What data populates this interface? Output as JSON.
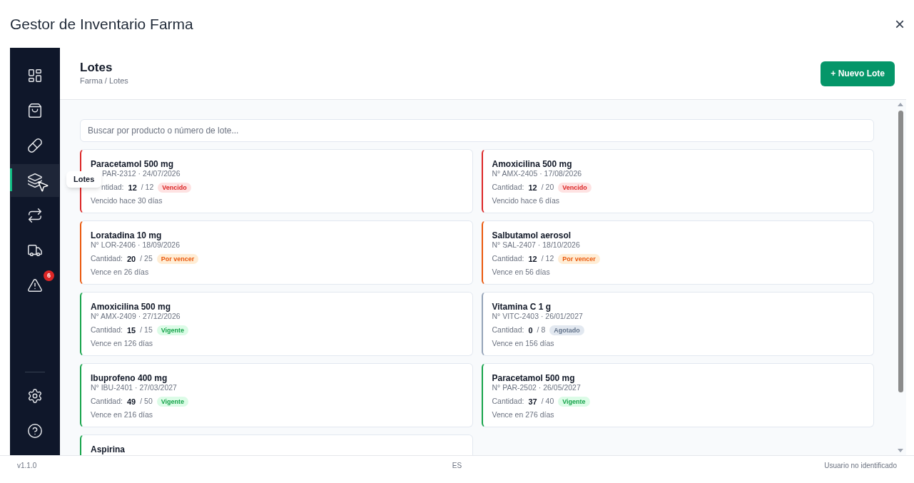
{
  "window": {
    "title": "Gestor de Inventario Farma",
    "close": "×"
  },
  "sidebar": {
    "items": [
      {
        "kind": "dashboard",
        "selected": false
      },
      {
        "kind": "sales",
        "selected": false
      },
      {
        "kind": "products",
        "selected": false
      },
      {
        "kind": "lots",
        "selected": true
      },
      {
        "kind": "movements",
        "selected": false
      },
      {
        "kind": "suppliers",
        "selected": false
      },
      {
        "kind": "alerts",
        "selected": false,
        "badge": "6"
      }
    ],
    "bottom_items": [
      {
        "kind": "settings",
        "selected": false
      },
      {
        "kind": "help",
        "selected": false
      }
    ],
    "tooltip": "Lotes"
  },
  "header": {
    "title": "Lotes",
    "breadcrumb": "Farma / Lotes",
    "new_button": "+ Nuevo Lote"
  },
  "search": {
    "placeholder": "Buscar por producto o número de lote..."
  },
  "lots": [
    {
      "name": "Paracetamol 500 mg",
      "lot": "PAR-2312 · 24/07/2026",
      "quantity_label": "ntidad:",
      "quantity": "12",
      "total": "/ 12",
      "status": "Vencido",
      "kind": "expired",
      "expiry": "Vencido hace 30 días",
      "covered": true
    },
    {
      "name": "Amoxicilina 500 mg",
      "lot": "N° AMX-2405 · 17/08/2026",
      "quantity_label": "Cantidad:",
      "quantity": "12",
      "total": "/ 20",
      "status": "Vencido",
      "kind": "expired",
      "expiry": "Vencido hace 6 días",
      "covered": false
    },
    {
      "name": "Loratadina 10 mg",
      "lot": "N° LOR-2406 · 18/09/2026",
      "quantity_label": "Cantidad:",
      "quantity": "20",
      "total": "/ 25",
      "status": "Por vencer",
      "kind": "expiring",
      "expiry": "Vence en 26 días",
      "covered": false
    },
    {
      "name": "Salbutamol aerosol",
      "lot": "N° SAL-2407 · 18/10/2026",
      "quantity_label": "Cantidad:",
      "quantity": "12",
      "total": "/ 12",
      "status": "Por vencer",
      "kind": "expiring",
      "expiry": "Vence en 56 días",
      "covered": false
    },
    {
      "name": "Amoxicilina 500 mg",
      "lot": "N° AMX-2409 · 27/12/2026",
      "quantity_label": "Cantidad:",
      "quantity": "15",
      "total": "/ 15",
      "status": "Vigente",
      "kind": "valid",
      "expiry": "Vence en 126 días",
      "covered": false
    },
    {
      "name": "Vitamina C 1 g",
      "lot": "N° VITC-2403 · 26/01/2027",
      "quantity_label": "Cantidad:",
      "quantity": "0",
      "total": "/ 8",
      "status": "Agotado",
      "kind": "depleted",
      "expiry": "Vence en 156 días",
      "covered": false
    },
    {
      "name": "Ibuprofeno 400 mg",
      "lot": "N° IBU-2401 · 27/03/2027",
      "quantity_label": "Cantidad:",
      "quantity": "49",
      "total": "/ 50",
      "status": "Vigente",
      "kind": "valid",
      "expiry": "Vence en 216 días",
      "covered": false
    },
    {
      "name": "Paracetamol 500 mg",
      "lot": "N° PAR-2502 · 26/05/2027",
      "quantity_label": "Cantidad:",
      "quantity": "37",
      "total": "/ 40",
      "status": "Vigente",
      "kind": "valid",
      "expiry": "Vence en 276 días",
      "covered": false
    },
    {
      "name": "Aspirina",
      "kind": "valid"
    }
  ],
  "footer": {
    "version": "v1.1.0",
    "language": "ES",
    "user": "Usuario no identificado"
  }
}
